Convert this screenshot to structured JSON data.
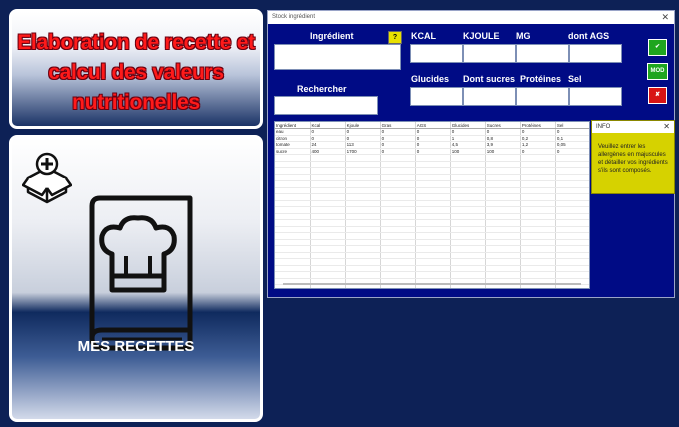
{
  "title_panel": {
    "text": "Elaboration de recette et calcul des valeurs nutritionelles"
  },
  "recipes_panel": {
    "label": "MES RECETTES"
  },
  "window": {
    "title": "Stock ingrédient",
    "close": "✕"
  },
  "form": {
    "ingredient_label": "Ingrédient",
    "help_label": "?",
    "search_label": "Rechercher",
    "kcal_label": "KCAL",
    "kjoule_label": "KJOULE",
    "mg_label": "MG",
    "ags_label": "dont AGS",
    "glucides_label": "Glucides",
    "sucres_label": "Dont sucres",
    "proteines_label": "Protéines",
    "sel_label": "Sel"
  },
  "buttons": {
    "add": "✔",
    "mod": "MOD",
    "delete": "✘"
  },
  "colors": {
    "add": "#1fa51f",
    "mod": "#1fa51f",
    "delete": "#d81414",
    "window_bg": "#000b85",
    "page_bg": "#0d2156"
  },
  "table": {
    "headers": [
      "Ingrédient",
      "Kcal",
      "Kjoule",
      "Gras",
      "AGS",
      "Glucides",
      "Sucres",
      "Protéines",
      "Sel"
    ],
    "rows": [
      [
        "eau",
        "0",
        "0",
        "0",
        "0",
        "0",
        "0",
        "0",
        "0"
      ],
      [
        "citron",
        "0",
        "0",
        "0",
        "0",
        "1",
        "0,8",
        "0,2",
        "0,1"
      ],
      [
        "tomate",
        "24",
        "113",
        "0",
        "0",
        "4,5",
        "3,9",
        "1,2",
        "0,05"
      ],
      [
        "sucre",
        "400",
        "1700",
        "0",
        "0",
        "100",
        "100",
        "0",
        "0"
      ]
    ]
  },
  "info": {
    "title": "INFO",
    "close": "✕",
    "text": "Veuillez entrer les allergènes en majuscules et détailler vos ingrédients s'ils sont composés."
  },
  "icons": {
    "box": "box-plus-icon",
    "recipes": "chef-book-icon"
  }
}
